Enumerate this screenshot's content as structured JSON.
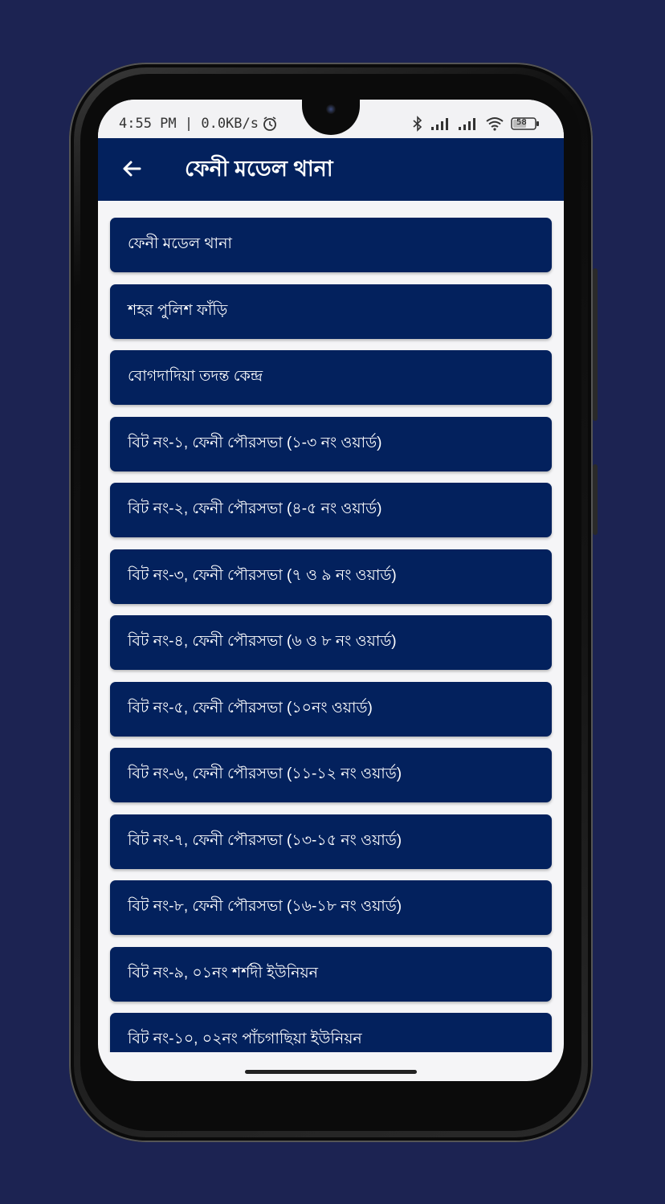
{
  "status_bar": {
    "time_net": "4:55 PM | 0.0KB/s",
    "battery": "58"
  },
  "app_bar": {
    "title": "ফেনী মডেল থানা"
  },
  "list": [
    "ফেনী মডেল থানা",
    "শহর পুলিশ ফাঁড়ি",
    "বোগদাদিয়া তদন্ত কেন্দ্র",
    "বিট নং-১, ফেনী পৌরসভা (১-৩ নং ওয়ার্ড)",
    "বিট নং-২, ফেনী পৌরসভা (৪-৫ নং ওয়ার্ড)",
    "বিট নং-৩, ফেনী পৌরসভা (৭ ও ৯ নং ওয়ার্ড)",
    "বিট নং-৪, ফেনী পৌরসভা (৬ ও ৮ নং ওয়ার্ড)",
    "বিট নং-৫, ফেনী পৌরসভা (১০নং ওয়ার্ড)",
    "বিট নং-৬, ফেনী পৌরসভা (১১-১২ নং ওয়ার্ড)",
    "বিট নং-৭, ফেনী পৌরসভা (১৩-১৫ নং ওয়ার্ড)",
    "বিট নং-৮, ফেনী পৌরসভা (১৬-১৮ নং ওয়ার্ড)",
    "বিট নং-৯, ০১নং শর্শদী ইউনিয়ন",
    "বিট নং-১০, ০২নং পাঁচগাছিয়া ইউনিয়ন"
  ],
  "colors": {
    "background": "#1c2352",
    "app_bar": "#03215d",
    "list_item": "#03215d",
    "screen": "#f5f5f7"
  },
  "icons": {
    "back": "arrow-left-icon",
    "alarm": "alarm-clock-icon",
    "bluetooth": "bluetooth-icon",
    "signal": "cell-signal-icon",
    "wifi": "wifi-icon",
    "battery": "battery-icon"
  }
}
